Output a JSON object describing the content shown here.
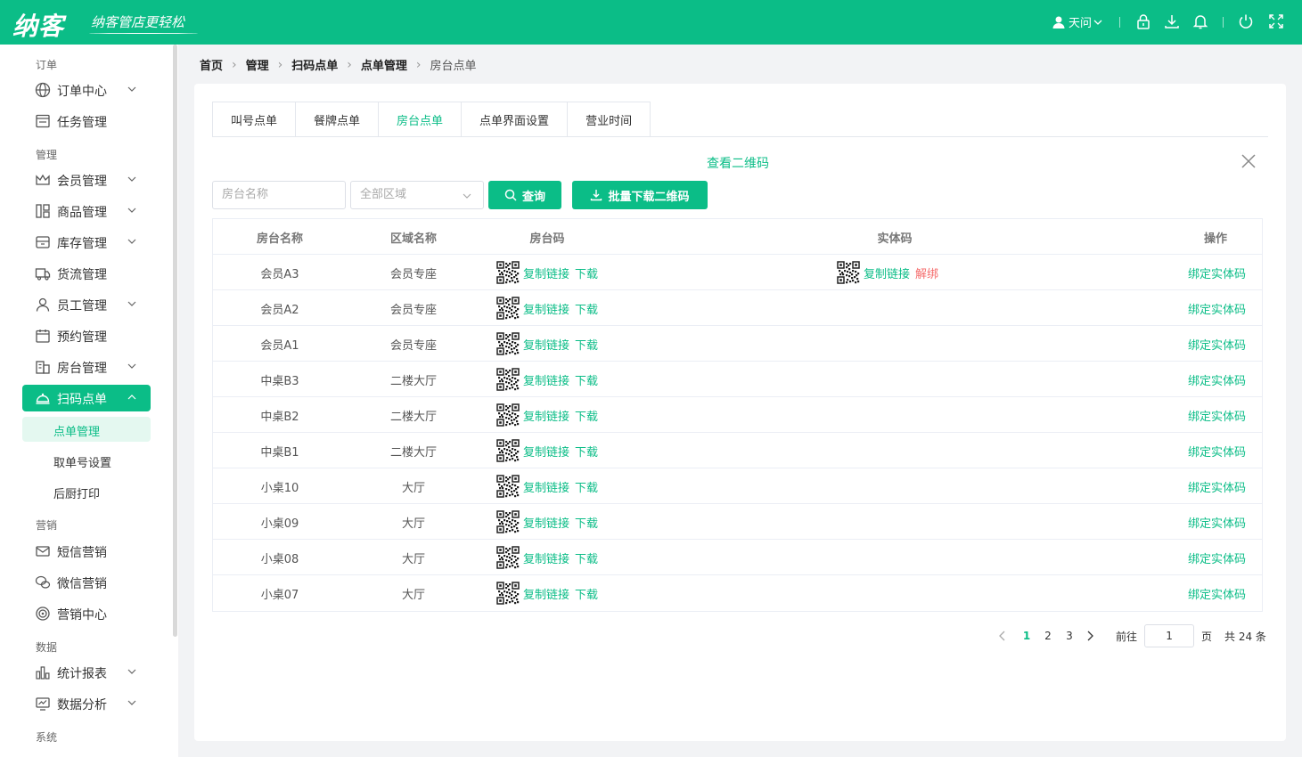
{
  "header": {
    "logo": "纳客",
    "slogan": "纳客管店更轻松",
    "user": "天问",
    "icons": [
      "lock-icon",
      "download-icon",
      "bell-icon",
      "power-icon",
      "fullscreen-icon"
    ],
    "color": "#0bbd87"
  },
  "sidebar": {
    "groups": {
      "order": "订单",
      "manage": "管理",
      "marketing": "营销",
      "data": "数据",
      "system": "系统"
    },
    "items": {
      "order_center": "订单中心",
      "task": "任务管理",
      "member": "会员管理",
      "goods": "商品管理",
      "stock": "库存管理",
      "logistics": "货流管理",
      "staff": "员工管理",
      "booking": "预约管理",
      "room": "房台管理",
      "scan_order": "扫码点单",
      "order_manage": "点单管理",
      "pickup_no": "取单号设置",
      "kitchen_print": "后厨打印",
      "sms": "短信营销",
      "wechat": "微信营销",
      "mkt_center": "营销中心",
      "stats": "统计报表",
      "analysis": "数据分析"
    }
  },
  "breadcrumb": [
    "首页",
    "管理",
    "扫码点单",
    "点单管理",
    "房台点单"
  ],
  "tabs": [
    "叫号点单",
    "餐牌点单",
    "房台点单",
    "点单界面设置",
    "营业时间"
  ],
  "view_qr": "查看二维码",
  "filters": {
    "name_placeholder": "房台名称",
    "area_placeholder": "全部区域",
    "search_label": "查询",
    "batch_label": "批量下载二维码"
  },
  "table": {
    "headers": [
      "房台名称",
      "区域名称",
      "房台码",
      "实体码",
      "操作"
    ],
    "copy_link": "复制链接",
    "download": "下载",
    "unbind": "解绑",
    "bind": "绑定实体码",
    "rows": [
      {
        "name": "会员A3",
        "area": "会员专座",
        "has_entity": true
      },
      {
        "name": "会员A2",
        "area": "会员专座",
        "has_entity": false
      },
      {
        "name": "会员A1",
        "area": "会员专座",
        "has_entity": false
      },
      {
        "name": "中桌B3",
        "area": "二楼大厅",
        "has_entity": false
      },
      {
        "name": "中桌B2",
        "area": "二楼大厅",
        "has_entity": false
      },
      {
        "name": "中桌B1",
        "area": "二楼大厅",
        "has_entity": false
      },
      {
        "name": "小桌10",
        "area": "大厅",
        "has_entity": false
      },
      {
        "name": "小桌09",
        "area": "大厅",
        "has_entity": false
      },
      {
        "name": "小桌08",
        "area": "大厅",
        "has_entity": false
      },
      {
        "name": "小桌07",
        "area": "大厅",
        "has_entity": false
      }
    ]
  },
  "pagination": {
    "pages": [
      "1",
      "2",
      "3"
    ],
    "current": "1",
    "goto_label": "前往",
    "goto_value": "1",
    "page_unit": "页",
    "total": "共 24 条"
  }
}
